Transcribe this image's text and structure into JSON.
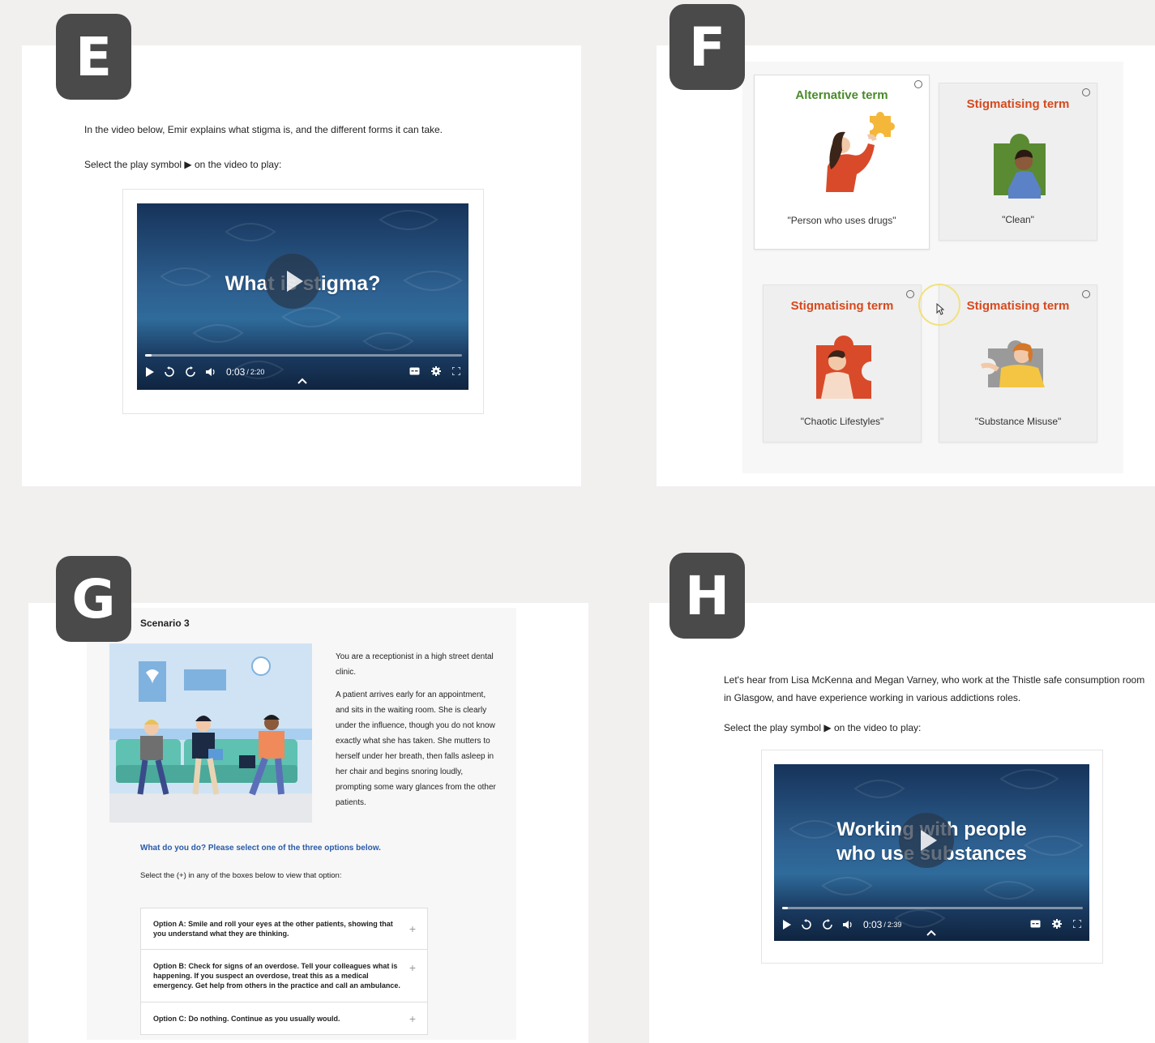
{
  "panels": {
    "e": {
      "badge": "E",
      "intro": "In the video below, Emir explains what stigma is, and the different forms it can take.",
      "instruction": "Select the play symbol ▶ on the video to play:",
      "video": {
        "title": "What is stigma?",
        "time_current": "0:03",
        "time_total": "2:20",
        "progress": 0.02
      }
    },
    "f": {
      "badge": "F",
      "cards": [
        {
          "title": "Alternative term",
          "quote": "\"Person who uses drugs\"",
          "title_color": "#4a8a2a"
        },
        {
          "title": "Stigmatising term",
          "quote": "\"Clean\"",
          "title_color": "#d6491d"
        },
        {
          "title": "Stigmatising term",
          "quote": "\"Chaotic Lifestyles\"",
          "title_color": "#d6491d"
        },
        {
          "title": "Stigmatising term",
          "quote": "\"Substance Misuse\"",
          "title_color": "#d6491d"
        }
      ]
    },
    "g": {
      "badge": "G",
      "heading": "Scenario 3",
      "para1": "You are a receptionist in a high street dental clinic.",
      "para2": "A patient arrives early for an appointment, and sits in the waiting room. She is clearly under the influence, though you do not know exactly what she has taken. She mutters to herself under her breath, then falls asleep in her chair and begins snoring loudly, prompting some wary glances from the other patients.",
      "question": "What do you do? Please select one of the three options below.",
      "instruction": "Select the (+) in any of the boxes below to view that option:",
      "options": [
        "Option A: Smile and roll your eyes at the other patients, showing that you understand what they are thinking.",
        "Option B: Check for signs of an overdose. Tell your colleagues what is happening. If you suspect an overdose, treat this as a medical emergency. Get help from others in the practice and call an ambulance.",
        "Option C: Do nothing. Continue as you usually would."
      ],
      "plus": "+"
    },
    "h": {
      "badge": "H",
      "intro_line1": "Let's hear from Lisa McKenna and Megan Varney, who work at the Thistle safe consumption room",
      "intro_line2": "in Glasgow, and have experience working in various addictions roles.",
      "instruction": "Select the play symbol ▶ on the video to play:",
      "video": {
        "title_line1": "Working with people",
        "title_line2": "who use substances",
        "time_current": "0:03",
        "time_total": "2:39",
        "progress": 0.02
      }
    }
  },
  "icons": {
    "play": "play-icon",
    "rewind": "rewind-10-icon",
    "forward": "forward-10-icon",
    "volume": "volume-icon",
    "captions": "captions-icon",
    "settings": "gear-icon",
    "fullscreen": "fullscreen-icon"
  },
  "colors": {
    "badge": "#4a4a4a",
    "alt_term": "#4a8a2a",
    "stigma_term": "#d6491d",
    "question_blue": "#2a5aa8",
    "video_dark": "#16335a"
  }
}
